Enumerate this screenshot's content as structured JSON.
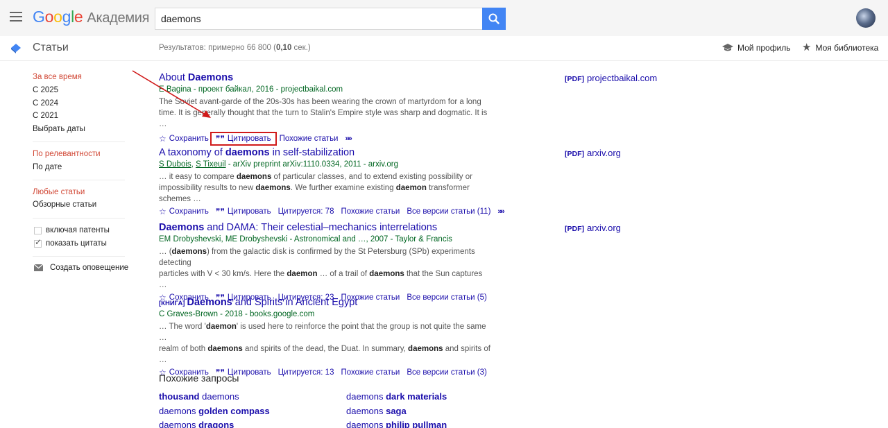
{
  "header": {
    "logo_letters": [
      "G",
      "o",
      "o",
      "g",
      "l",
      "e"
    ],
    "logo_suffix": "Академия",
    "search_value": "daemons",
    "colors": {
      "header_bg": "#f5f5f5",
      "search_button": "#4285f4"
    }
  },
  "subheader": {
    "section_label": "Статьи",
    "results_prefix": "Результатов: примерно 66 800 (",
    "results_time": "0,10",
    "results_suffix": " сек.)",
    "my_profile": "Мой профиль",
    "my_library": "Моя библиотека"
  },
  "sidebar": {
    "time_filters": [
      "За все время",
      "С 2025",
      "С 2024",
      "С 2021",
      "Выбрать даты"
    ],
    "sort_options": [
      "По релевантности",
      "По дате"
    ],
    "type_options": [
      "Любые статьи",
      "Обзорные статьи"
    ],
    "include_patents": "включая патенты",
    "show_citations": "показать цитаты",
    "create_alert": "Создать оповещение",
    "active_color": "#d14836"
  },
  "results": [
    {
      "title_pre": "About ",
      "title_bold": "Daemons",
      "title_post": "",
      "meta": "E Bagina - проект байкал, 2016 - projectbaikal.com",
      "snippet_1": "The Soviet avant-garde of the 20s-30s has been wearing the crown of martyrdom for a long",
      "snippet_2": "time. It is generally thought that the turn to Stalin's Empire style was sharp and dogmatic. It is …",
      "save": "Сохранить",
      "cite": "Цитировать",
      "related": "Похожие статьи",
      "pdf_tag": "[PDF]",
      "pdf_source": "projectbaikal.com"
    },
    {
      "title_pre": "A taxonomy of ",
      "title_bold": "daemons",
      "title_post": " in self-stabilization",
      "author_1": "S Dubois",
      "author_2": "S Tixeuil",
      "meta_rest": " - arXiv preprint arXiv:1110.0334, 2011 - arxiv.org",
      "snip_a": "… it easy to compare ",
      "snip_b": "daemons",
      "snip_c": " of particular classes, and to extend existing possibility or",
      "snip_d": "impossibility results to new ",
      "snip_e": "daemons",
      "snip_f": ". We further examine existing ",
      "snip_g": "daemon",
      "snip_h": " transformer schemes …",
      "save": "Сохранить",
      "cite": "Цитировать",
      "cited_by": "Цитируется: 78",
      "related": "Похожие статьи",
      "versions": "Все версии статьи (11)",
      "pdf_tag": "[PDF]",
      "pdf_source": "arxiv.org"
    },
    {
      "title_bold": "Daemons",
      "title_post": " and DAMA: Their celestial–mechanics interrelations",
      "meta": "EM Drobyshevski, ME Drobyshevski - Astronomical and …, 2007 - Taylor & Francis",
      "snip_a": "… (",
      "snip_b": "daemons",
      "snip_c": ") from the galactic disk is confirmed by the St Petersburg (SPb) experiments detecting",
      "snip_d": "particles with V < 30 km/s. Here the ",
      "snip_e": "daemon",
      "snip_f": " … of a trail of ",
      "snip_g": "daemons",
      "snip_h": " that the Sun captures …",
      "save": "Сохранить",
      "cite": "Цитировать",
      "cited_by": "Цитируется: 23",
      "related": "Похожие статьи",
      "versions": "Все версии статьи (5)",
      "pdf_tag": "[PDF]",
      "pdf_source": "arxiv.org"
    },
    {
      "book_tag": "[КНИГА]",
      "title_bold": "Daemons",
      "title_post": " and Spirits in Ancient Egypt",
      "meta": "C Graves-Brown - 2018 - books.google.com",
      "snip_a": "… The word '",
      "snip_b": "daemon",
      "snip_c": "' is used here to reinforce the point that the group is not quite the same …",
      "snip_d": "realm of both ",
      "snip_e": "daemons",
      "snip_f": " and spirits of the dead, the Duat. In summary, ",
      "snip_g": "daemons",
      "snip_h": " and spirits of …",
      "save": "Сохранить",
      "cite": "Цитировать",
      "cited_by": "Цитируется: 13",
      "related": "Похожие статьи",
      "versions": "Все версии статьи (3)"
    }
  ],
  "related_searches": {
    "title": "Похожие запросы",
    "items": [
      {
        "bold_first": true,
        "a": "thousand",
        "b": " daemons"
      },
      {
        "bold_first": false,
        "a": "daemons ",
        "b": "dark materials"
      },
      {
        "bold_first": false,
        "a": "daemons ",
        "b": "golden compass"
      },
      {
        "bold_first": false,
        "a": "daemons ",
        "b": "saga"
      },
      {
        "bold_first": false,
        "a": "daemons ",
        "b": "dragons"
      },
      {
        "bold_first": false,
        "a": "daemons ",
        "b": "philip pullman"
      }
    ]
  },
  "annotation": {
    "arrow_color": "#d01919"
  }
}
